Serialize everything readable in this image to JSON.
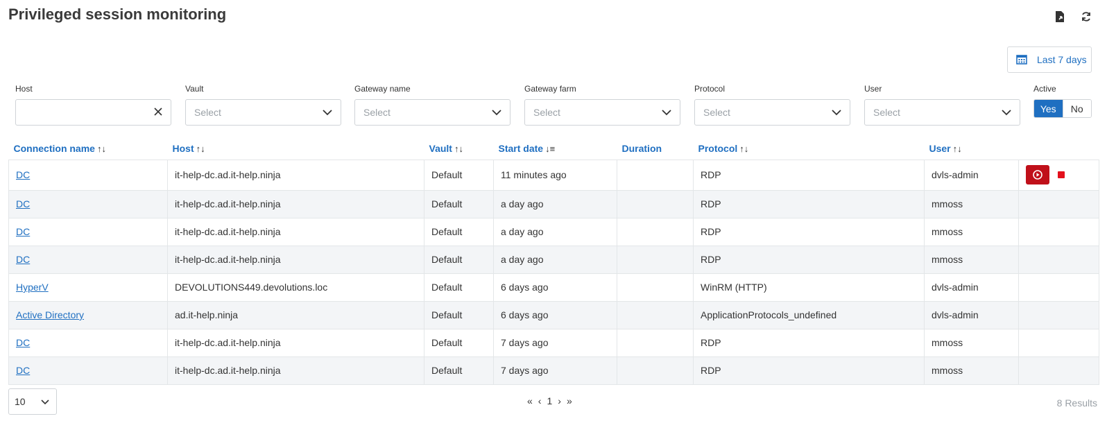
{
  "page": {
    "title": "Privileged session monitoring"
  },
  "toolbar": {
    "export_icon": "export-file-icon",
    "refresh_icon": "refresh-icon"
  },
  "date_range": {
    "label": "Last 7 days",
    "icon": "calendar-icon"
  },
  "filters": {
    "host": {
      "label": "Host",
      "value": ""
    },
    "vault": {
      "label": "Vault",
      "placeholder": "Select"
    },
    "gateway_name": {
      "label": "Gateway name",
      "placeholder": "Select"
    },
    "gateway_farm": {
      "label": "Gateway farm",
      "placeholder": "Select"
    },
    "protocol": {
      "label": "Protocol",
      "placeholder": "Select"
    },
    "user": {
      "label": "User",
      "placeholder": "Select"
    },
    "active": {
      "label": "Active",
      "yes": "Yes",
      "no": "No",
      "selected": "Yes"
    }
  },
  "table": {
    "columns": {
      "connection_name": "Connection name",
      "host": "Host",
      "vault": "Vault",
      "start_date": "Start date",
      "duration": "Duration",
      "protocol": "Protocol",
      "user": "User"
    },
    "rows": [
      {
        "name": "DC",
        "host": "it-help-dc.ad.it-help.ninja",
        "vault": "Default",
        "start": "11 minutes ago",
        "duration": "",
        "protocol": "RDP",
        "user": "dvls-admin"
      },
      {
        "name": "DC",
        "host": "it-help-dc.ad.it-help.ninja",
        "vault": "Default",
        "start": "a day ago",
        "duration": "",
        "protocol": "RDP",
        "user": "mmoss"
      },
      {
        "name": "DC",
        "host": "it-help-dc.ad.it-help.ninja",
        "vault": "Default",
        "start": "a day ago",
        "duration": "",
        "protocol": "RDP",
        "user": "mmoss"
      },
      {
        "name": "DC",
        "host": "it-help-dc.ad.it-help.ninja",
        "vault": "Default",
        "start": "a day ago",
        "duration": "",
        "protocol": "RDP",
        "user": "mmoss"
      },
      {
        "name": "HyperV",
        "host": "DEVOLUTIONS449.devolutions.loc",
        "vault": "Default",
        "start": "6 days ago",
        "duration": "",
        "protocol": "WinRM (HTTP)",
        "user": "dvls-admin"
      },
      {
        "name": "Active Directory",
        "host": "ad.it-help.ninja",
        "vault": "Default",
        "start": "6 days ago",
        "duration": "",
        "protocol": "ApplicationProtocols_undefined",
        "user": "dvls-admin"
      },
      {
        "name": "DC",
        "host": "it-help-dc.ad.it-help.ninja",
        "vault": "Default",
        "start": "7 days ago",
        "duration": "",
        "protocol": "RDP",
        "user": "mmoss"
      },
      {
        "name": "DC",
        "host": "it-help-dc.ad.it-help.ninja",
        "vault": "Default",
        "start": "7 days ago",
        "duration": "",
        "protocol": "RDP",
        "user": "mmoss"
      }
    ]
  },
  "pagination": {
    "page_size": "10",
    "current_page": "1",
    "results": "8 Results"
  },
  "colors": {
    "accent": "#1f6fc1",
    "danger": "#c0101a",
    "stripe": "#f3f5f7"
  }
}
